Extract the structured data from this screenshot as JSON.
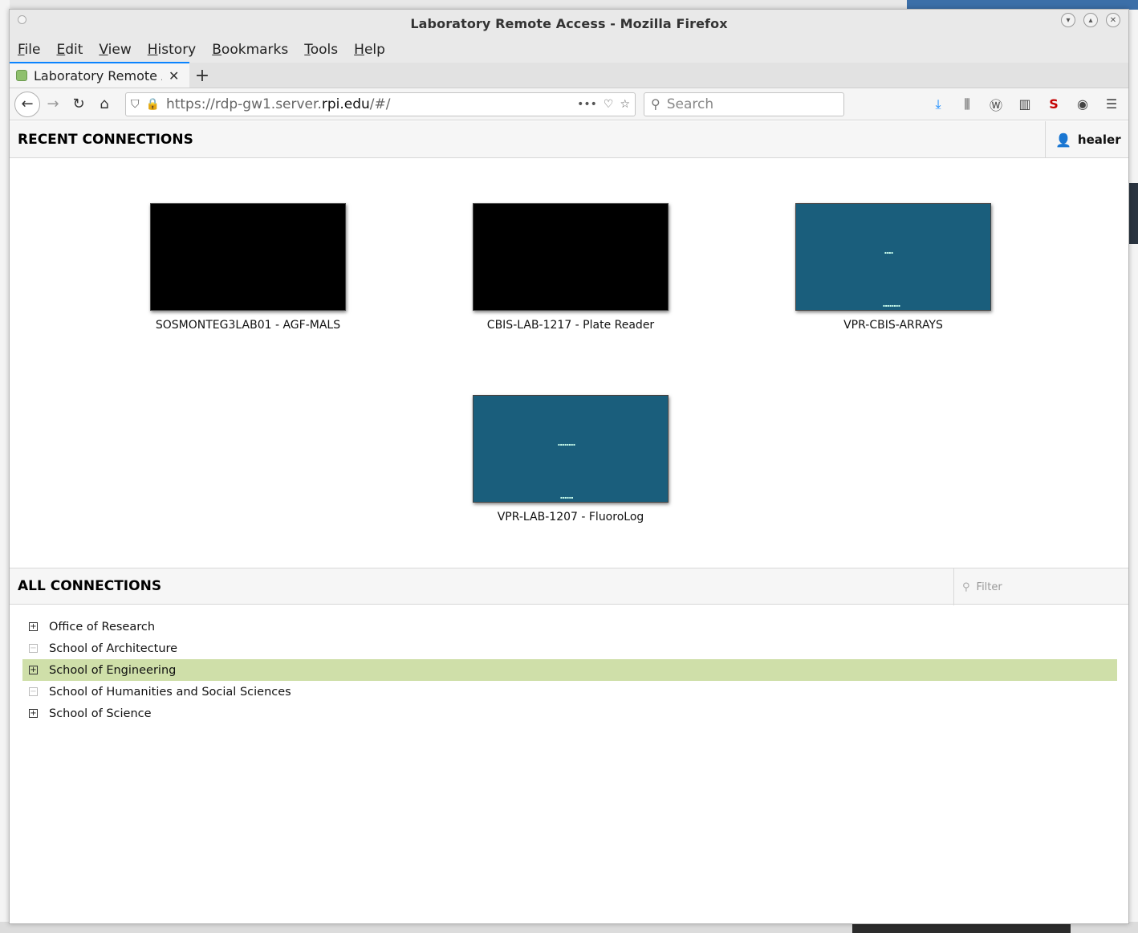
{
  "window": {
    "title": "Laboratory Remote Access - Mozilla Firefox",
    "controls": [
      "minimize",
      "maximize",
      "close"
    ]
  },
  "menubar": {
    "items": [
      "File",
      "Edit",
      "View",
      "History",
      "Bookmarks",
      "Tools",
      "Help"
    ]
  },
  "tabs": [
    {
      "title": "Laboratory Remote Access"
    }
  ],
  "navbar": {
    "url_prefix": "https://rdp-gw1.server.",
    "url_domain": "rpi.edu",
    "url_suffix": "/#/",
    "search_placeholder": "Search"
  },
  "recent": {
    "title": "RECENT CONNECTIONS",
    "user": "healer",
    "connections": [
      {
        "label": "SOSMONTEG3LAB01 - AGF-MALS",
        "preview": "black"
      },
      {
        "label": "CBIS-LAB-1217 - Plate Reader",
        "preview": "black"
      },
      {
        "label": "VPR-CBIS-ARRAYS",
        "preview": "blue"
      },
      {
        "label": "VPR-LAB-1207 - FluoroLog",
        "preview": "blue"
      }
    ]
  },
  "all": {
    "title": "ALL CONNECTIONS",
    "filter_placeholder": "Filter",
    "groups": [
      {
        "name": "Office of Research",
        "toggle": "⊞",
        "expandable": true,
        "selected": false
      },
      {
        "name": "School of Architecture",
        "toggle": "⊟",
        "expandable": false,
        "selected": false
      },
      {
        "name": "School of Engineering",
        "toggle": "⊞",
        "expandable": true,
        "selected": true
      },
      {
        "name": "School of Humanities and Social Sciences",
        "toggle": "⊟",
        "expandable": false,
        "selected": false
      },
      {
        "name": "School of Science",
        "toggle": "⊞",
        "expandable": true,
        "selected": false
      }
    ]
  },
  "colors": {
    "selected_row": "#cfdfa9",
    "preview_blue": "#1a5e7c",
    "accent": "#0a84ff"
  }
}
